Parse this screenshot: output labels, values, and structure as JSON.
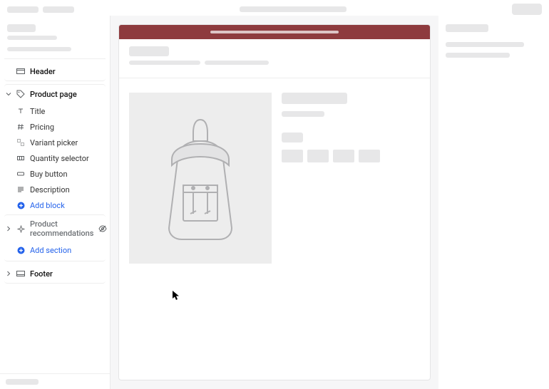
{
  "colors": {
    "accent": "#2563eb",
    "announcement_bg": "#8e3b3e"
  },
  "sidebar": {
    "header": {
      "label": "Header"
    },
    "product_page": {
      "label": "Product page",
      "blocks": [
        {
          "id": "title",
          "label": "Title"
        },
        {
          "id": "pricing",
          "label": "Pricing"
        },
        {
          "id": "variant-picker",
          "label": "Variant picker"
        },
        {
          "id": "quantity-selector",
          "label": "Quantity selector"
        },
        {
          "id": "buy-button",
          "label": "Buy button"
        },
        {
          "id": "description",
          "label": "Description"
        }
      ],
      "add_block_label": "Add block"
    },
    "product_recommendations": {
      "label": "Product recommendations",
      "hidden": true
    },
    "add_section_label": "Add section",
    "footer": {
      "label": "Footer"
    }
  }
}
